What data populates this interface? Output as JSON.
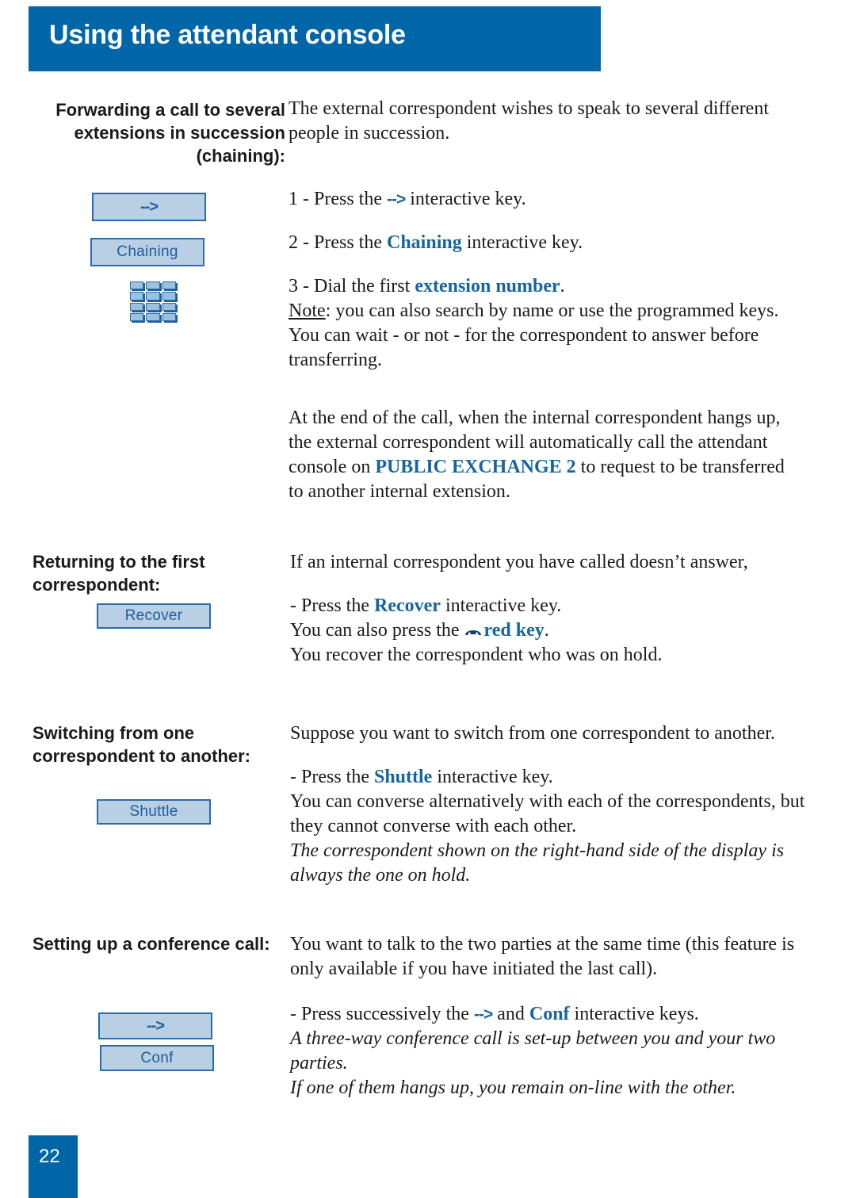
{
  "page": {
    "header_title": "Using the attendant console",
    "page_number": "22",
    "accent_color": "#0066a8",
    "keyword_color": "#16659f",
    "softkey_fill": "#b9cfe3",
    "softkey_border": "#2b6ca8"
  },
  "sections": [
    {
      "id": "chaining",
      "heading": "Forwarding a call to several extensions in succession (chaining):",
      "intro": "The external correspondent wishes to speak to several different people in succession.",
      "softkeys": [
        {
          "name": "arrow",
          "label": "-->"
        },
        {
          "name": "chaining",
          "label": "Chaining"
        }
      ],
      "icons": [
        {
          "name": "keypad-icon",
          "rows": 4,
          "cols": 3
        }
      ],
      "steps": [
        {
          "num": "1 - ",
          "pre": "Press the ",
          "key": "-->",
          "post": " interactive key."
        },
        {
          "num": "2 - ",
          "pre": "Press the ",
          "key": "Chaining",
          "post": " interactive key."
        },
        {
          "num": "3 - ",
          "pre": "Dial the first ",
          "key": "extension number",
          "post": "."
        }
      ],
      "note_label": "Note",
      "note_text": ": you can also search by name or use the programmed keys.",
      "wait_text": "You can wait - or not - for the correspondent to answer before transferring.",
      "end_call_pre": "At the end of the call, when the internal correspondent hangs up, the external correspondent will automatically call the attendant console on ",
      "end_call_key": "PUBLIC EXCHANGE 2",
      "end_call_post": " to request to be transferred to another internal extension."
    },
    {
      "id": "returning",
      "heading": "Returning to the first correspondent:",
      "intro": "If an internal correspondent you have called doesn’t answer,",
      "softkeys": [
        {
          "name": "recover",
          "label": "Recover"
        }
      ],
      "press_pre": "- Press the ",
      "press_key": "Recover",
      "press_post": " interactive key.",
      "also_pre": "You can also press the ",
      "also_icon": "handset-icon",
      "also_key": "red key",
      "also_post": ".",
      "result": "You recover the correspondent who was on hold."
    },
    {
      "id": "switching",
      "heading": "Switching from one correspondent to another:",
      "intro": "Suppose you want to switch from one correspondent to another.",
      "softkeys": [
        {
          "name": "shuttle",
          "label": "Shuttle"
        }
      ],
      "press_pre": "- Press the ",
      "press_key": "Shuttle",
      "press_post": " interactive key.",
      "detail": "You can converse alternatively with each of the correspondents, but they cannot converse with each other.",
      "italic_note": "The correspondent shown on the right-hand side of the display is always the one on hold."
    },
    {
      "id": "conference",
      "heading": "Setting up a conference call:",
      "intro": "You want to talk to the two parties at the same time (this feature is only available if you have initiated the last call).",
      "softkeys": [
        {
          "name": "arrow",
          "label": "-->"
        },
        {
          "name": "conf",
          "label": "Conf"
        }
      ],
      "press_pre": "- Press successively the ",
      "press_key1": "-->",
      "press_mid": " and ",
      "press_key2": "Conf",
      "press_post": " interactive keys.",
      "italic_note1": "A three-way conference call is set-up between you and your two parties.",
      "italic_note2": "If one of them hangs up, you remain on-line with the other."
    }
  ]
}
